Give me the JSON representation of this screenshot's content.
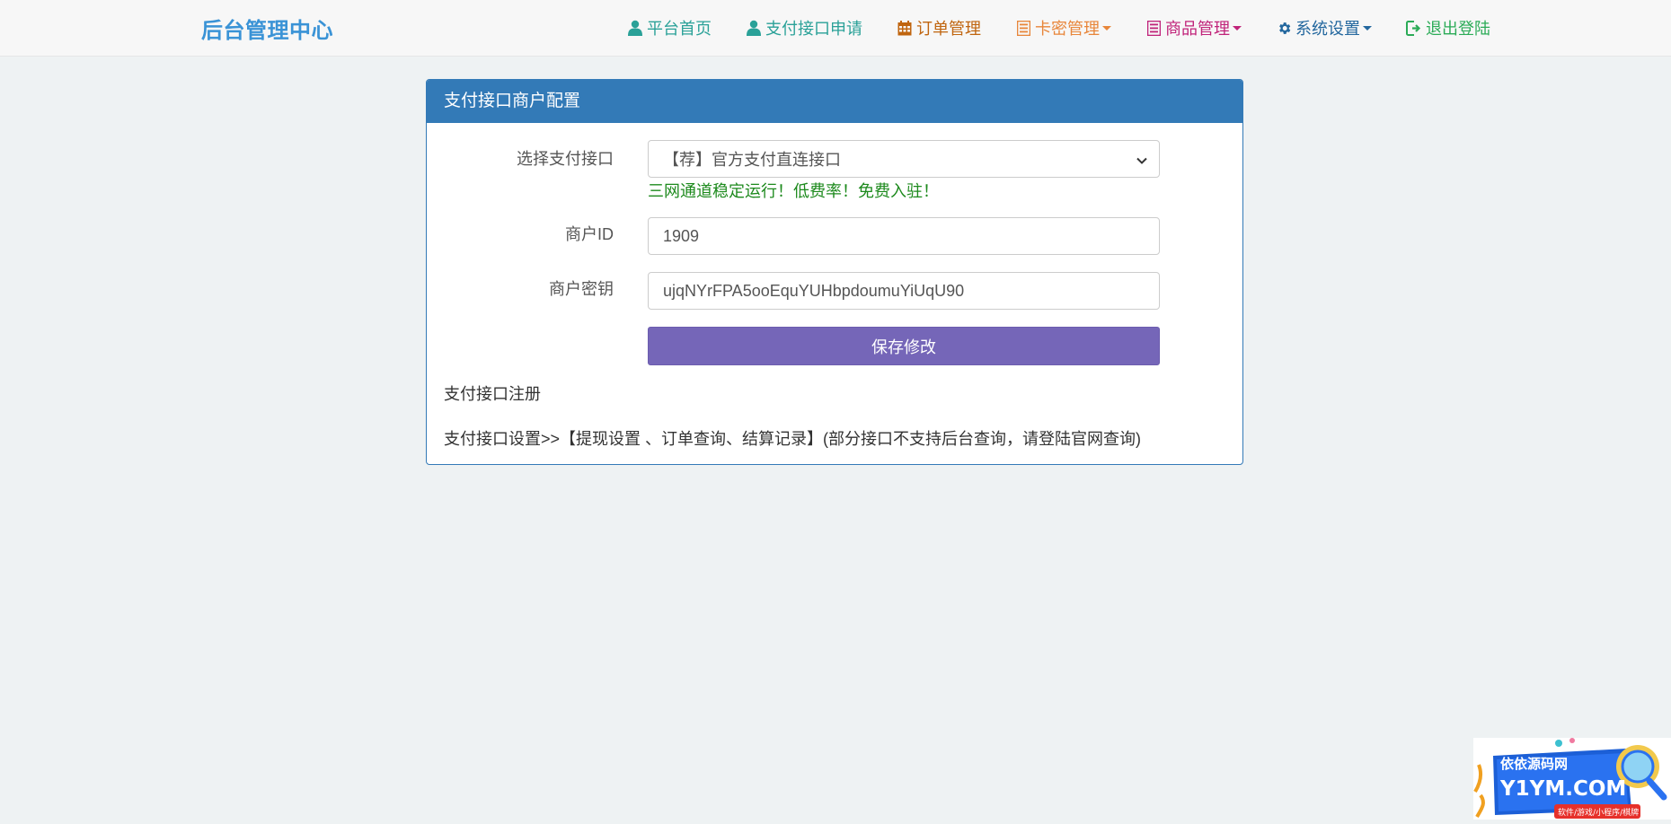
{
  "brand": "后台管理中心",
  "nav": [
    {
      "label": "平台首页",
      "icon": "user-icon",
      "color": "#2aa198",
      "dropdown": false
    },
    {
      "label": "支付接口申请",
      "icon": "user-icon",
      "color": "#2aa198",
      "dropdown": false
    },
    {
      "label": "订单管理",
      "icon": "calendar-icon",
      "color": "#c0650f",
      "dropdown": false
    },
    {
      "label": "卡密管理",
      "icon": "list-icon",
      "color": "#e8863a",
      "dropdown": true
    },
    {
      "label": "商品管理",
      "icon": "list-icon",
      "color": "#c0237a",
      "dropdown": true
    },
    {
      "label": "系统设置",
      "icon": "gear-icon",
      "color": "#23679e",
      "dropdown": true
    },
    {
      "label": "退出登陆",
      "icon": "logout-icon",
      "color": "#2bab57",
      "dropdown": false
    }
  ],
  "panel": {
    "title": "支付接口商户配置",
    "select_label": "选择支付接口",
    "select_value": "【荐】官方支付直连接口",
    "hint": "三网通道稳定运行！低费率！免费入驻！",
    "merchant_id_label": "商户ID",
    "merchant_id_value": "1909",
    "merchant_key_label": "商户密钥",
    "merchant_key_value": "ujqNYrFPA5ooEquYUHbpdoumuYiUqU90",
    "save_label": "保存修改",
    "register_link": "支付接口注册",
    "settings_link": "支付接口设置>>【提现设置 、订单查询、结算记录】(部分接口不支持后台查询，请登陆官网查询)"
  },
  "watermark": {
    "line1": "依依源码网",
    "line2": "Y1YM.COM",
    "line3": "软件/游戏/小程序/棋牌"
  },
  "colors": {
    "brand": "#3a93d6",
    "panel_header": "#337ab7",
    "save_button": "#7566b8",
    "hint": "#1d8a1d",
    "background": "#eef2f3"
  }
}
